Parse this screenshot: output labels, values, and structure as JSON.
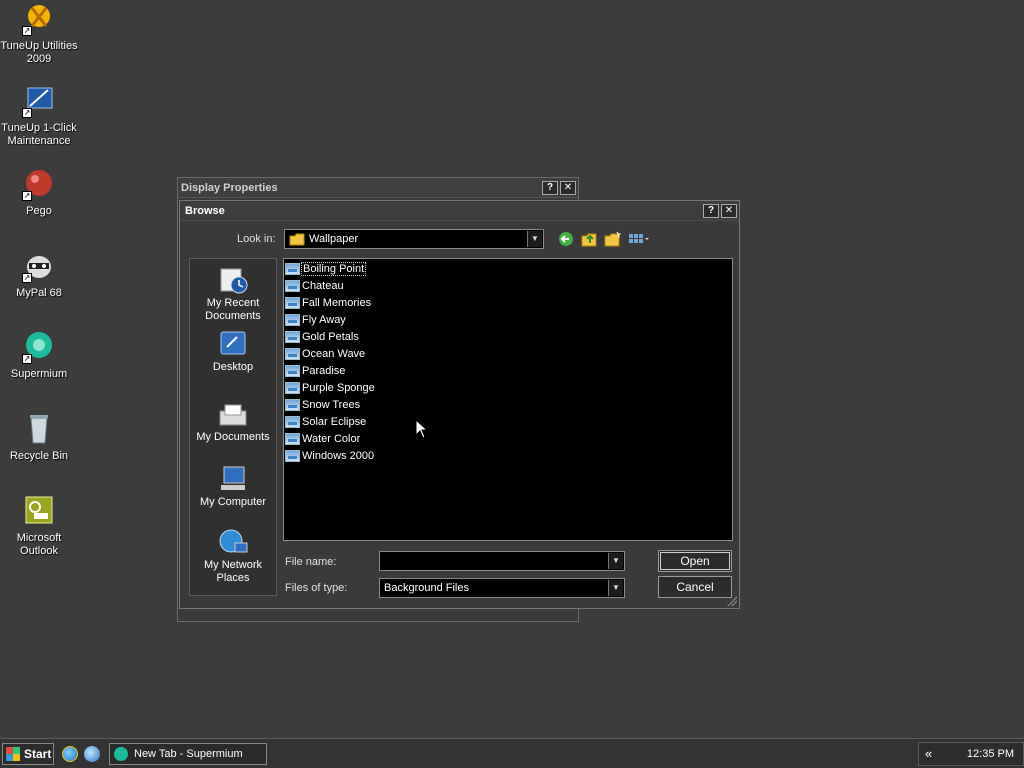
{
  "desktop": {
    "icons": [
      {
        "label": "TuneUp Utilities 2009",
        "icon": "tuneup-utilities-icon"
      },
      {
        "label": "TuneUp 1-Click Maintenance",
        "icon": "tuneup-1click-icon"
      },
      {
        "label": "Pego",
        "icon": "pego-icon"
      },
      {
        "label": "MyPal 68",
        "icon": "mypal-icon"
      },
      {
        "label": "Supermium",
        "icon": "supermium-icon"
      },
      {
        "label": "Recycle Bin",
        "icon": "recycle-bin-icon"
      },
      {
        "label": "Microsoft Outlook",
        "icon": "outlook-icon"
      }
    ]
  },
  "back_window": {
    "title": "Display Properties",
    "help": "?",
    "close": "✕"
  },
  "dialog": {
    "title": "Browse",
    "help": "?",
    "close": "✕",
    "look_in_label": "Look in:",
    "look_in_value": "Wallpaper",
    "places": [
      {
        "label": "My Recent Documents",
        "icon": "recent-documents-icon"
      },
      {
        "label": "Desktop",
        "icon": "desktop-icon"
      },
      {
        "label": "My Documents",
        "icon": "my-documents-icon"
      },
      {
        "label": "My Computer",
        "icon": "my-computer-icon"
      },
      {
        "label": "My Network Places",
        "icon": "network-places-icon"
      }
    ],
    "files": [
      "Boiling Point",
      "Chateau",
      "Fall Memories",
      "Fly Away",
      "Gold Petals",
      "Ocean Wave",
      "Paradise",
      "Purple Sponge",
      "Snow Trees",
      "Solar Eclipse",
      "Water Color",
      "Windows 2000"
    ],
    "selected_file": "Boiling Point",
    "file_name_label": "File name:",
    "file_name_value": "",
    "files_of_type_label": "Files of type:",
    "files_of_type_value": "Background Files",
    "open_label": "Open",
    "cancel_label": "Cancel"
  },
  "taskbar": {
    "start_label": "Start",
    "task_label": "New Tab - Supermium",
    "chevron": "«",
    "clock": "12:35 PM"
  }
}
